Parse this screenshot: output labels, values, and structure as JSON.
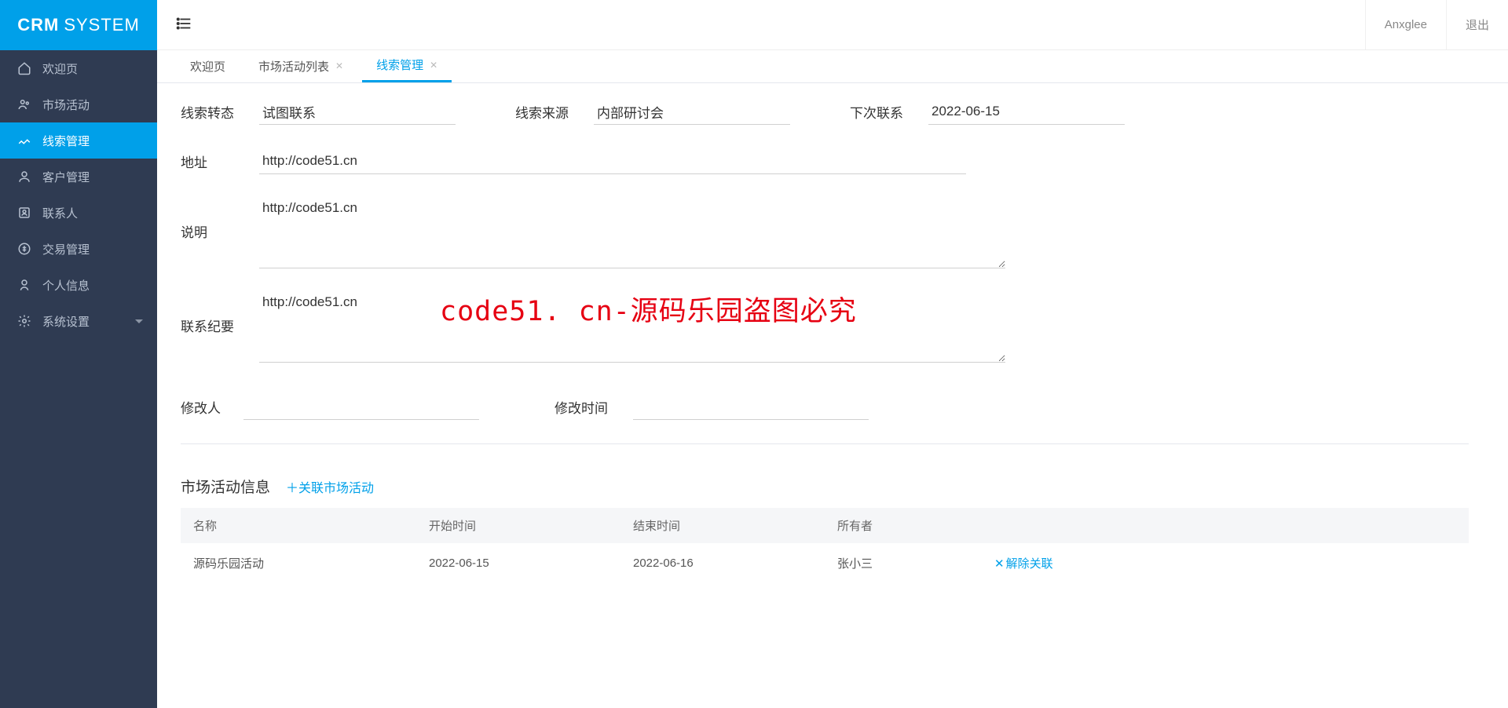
{
  "brand": {
    "bold": "CRM",
    "light": "SYSTEM"
  },
  "sidebar": {
    "items": [
      {
        "label": "欢迎页"
      },
      {
        "label": "市场活动"
      },
      {
        "label": "线索管理"
      },
      {
        "label": "客户管理"
      },
      {
        "label": "联系人"
      },
      {
        "label": "交易管理"
      },
      {
        "label": "个人信息"
      },
      {
        "label": "系统设置"
      }
    ]
  },
  "header": {
    "user": "Anxglee",
    "logout": "退出"
  },
  "tabs": [
    {
      "label": "欢迎页",
      "closable": false
    },
    {
      "label": "市场活动列表",
      "closable": true
    },
    {
      "label": "线索管理",
      "closable": true,
      "active": true
    }
  ],
  "form": {
    "lead_state_label": "线索转态",
    "lead_state_value": "试图联系",
    "lead_source_label": "线索来源",
    "lead_source_value": "内部研讨会",
    "next_contact_label": "下次联系",
    "next_contact_value": "2022-06-15",
    "address_label": "地址",
    "address_value": "http://code51.cn",
    "desc_label": "说明",
    "desc_value": "http://code51.cn",
    "contact_notes_label": "联系纪要",
    "contact_notes_value": "http://code51.cn",
    "editor_label": "修改人",
    "editor_value": "",
    "edit_time_label": "修改时间",
    "edit_time_value": ""
  },
  "activity": {
    "section_title": "市场活动信息",
    "link_button": "＋关联市场活动",
    "columns": [
      "名称",
      "开始时间",
      "结束时间",
      "所有者",
      ""
    ],
    "rows": [
      {
        "name": "源码乐园活动",
        "start": "2022-06-15",
        "end": "2022-06-16",
        "owner": "张小三",
        "action": "解除关联"
      }
    ]
  },
  "watermark": "code51. cn-源码乐园盗图必究"
}
